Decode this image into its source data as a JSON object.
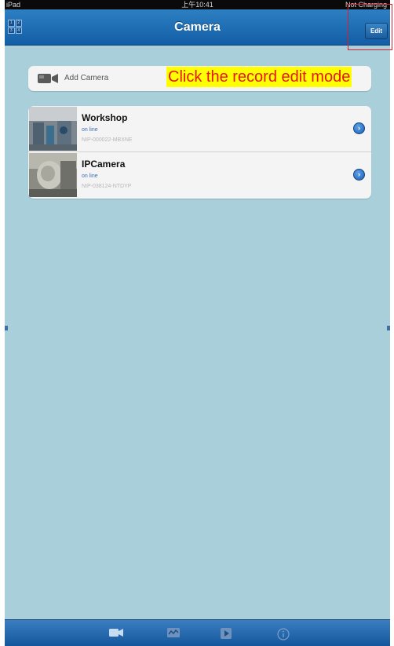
{
  "status_bar": {
    "carrier": "iPad",
    "time": "上午10:41",
    "battery": "Not Charging"
  },
  "nav": {
    "title": "Camera",
    "edit_label": "Edit",
    "grid_cells": [
      "1",
      "2",
      "3",
      "4"
    ]
  },
  "add_camera": {
    "label": "Add Camera"
  },
  "annotation": "Click the record edit mode",
  "cameras": [
    {
      "name": "Workshop",
      "status": "on line",
      "id": "NIP-000022-MBXNE"
    },
    {
      "name": "IPCamera",
      "status": "on line",
      "id": "NIP-038124-NTDYP"
    }
  ],
  "tabs": [
    {
      "icon": "camera-icon",
      "label": ""
    },
    {
      "icon": "playback-icon",
      "label": ""
    },
    {
      "icon": "play-icon",
      "label": ""
    },
    {
      "icon": "info-icon",
      "label": ""
    }
  ],
  "colors": {
    "background": "#a9cfdb",
    "nav_bar": "#1f6fb5",
    "highlight": "#d81e2c",
    "annotation_bg": "#ffff00",
    "annotation_text": "#e8141b"
  }
}
